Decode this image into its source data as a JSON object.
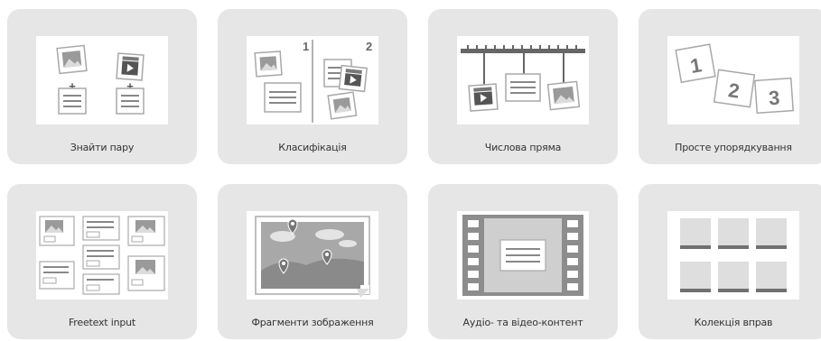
{
  "tiles": [
    {
      "label": "Знайти пару",
      "icon": "find-pair-icon"
    },
    {
      "label": "Класифікація",
      "icon": "classification-icon"
    },
    {
      "label": "Числова пряма",
      "icon": "number-line-icon"
    },
    {
      "label": "Просте упорядкування",
      "icon": "simple-ordering-icon"
    },
    {
      "label": "Freetext input",
      "icon": "freetext-input-icon"
    },
    {
      "label": "Фрагменти зображення",
      "icon": "image-fragments-icon"
    },
    {
      "label": "Аудіо- та відео-контент",
      "icon": "audio-video-content-icon"
    },
    {
      "label": "Колекція вправ",
      "icon": "exercise-collection-icon"
    }
  ],
  "thumb_text": {
    "classification_left_num": "1",
    "classification_right_num": "2",
    "ordering_num_1": "1",
    "ordering_num_2": "2",
    "ordering_num_3": "3"
  },
  "colors": {
    "tile_bg": "#e6e6e6",
    "icon_gray": "#7a7a7a",
    "card_border": "#b5b5b5"
  }
}
